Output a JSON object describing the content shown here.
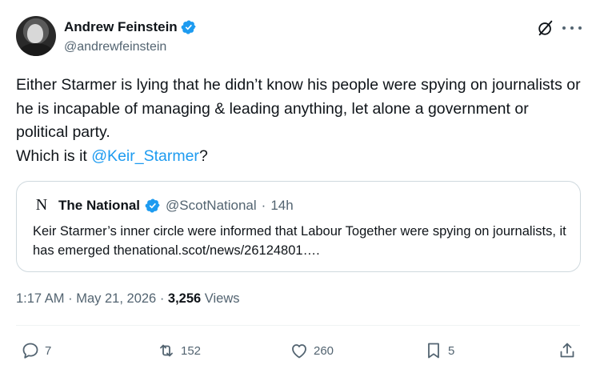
{
  "author": {
    "name": "Andrew Feinstein",
    "handle": "@andrewfeinstein",
    "verified": true
  },
  "tweet": {
    "line1": "Either Starmer is lying that he didn’t know his people were spying on journalists or he is incapable of managing & leading anything, let alone a government or political party.",
    "line2_prefix": "Which is it ",
    "mention": "@Keir_Starmer",
    "line2_suffix": "?"
  },
  "quote": {
    "logo": "N",
    "name": "The National",
    "handle": "@ScotNational",
    "separator": "·",
    "time": "14h",
    "text": "Keir Starmer’s inner circle were informed that Labour Together were spying on journalists, it has emerged thenational.scot/news/26124801…."
  },
  "meta": {
    "time": "1:17 AM",
    "separator": "·",
    "date": "May 21, 2026",
    "separator2": "·",
    "views_count": "3,256",
    "views_label": "Views"
  },
  "actions": {
    "replies": "7",
    "reposts": "152",
    "likes": "260",
    "bookmarks": "5"
  },
  "colors": {
    "accent": "#1d9bf0",
    "text": "#0f1419",
    "secondary": "#536471",
    "border": "#cfd9de"
  }
}
